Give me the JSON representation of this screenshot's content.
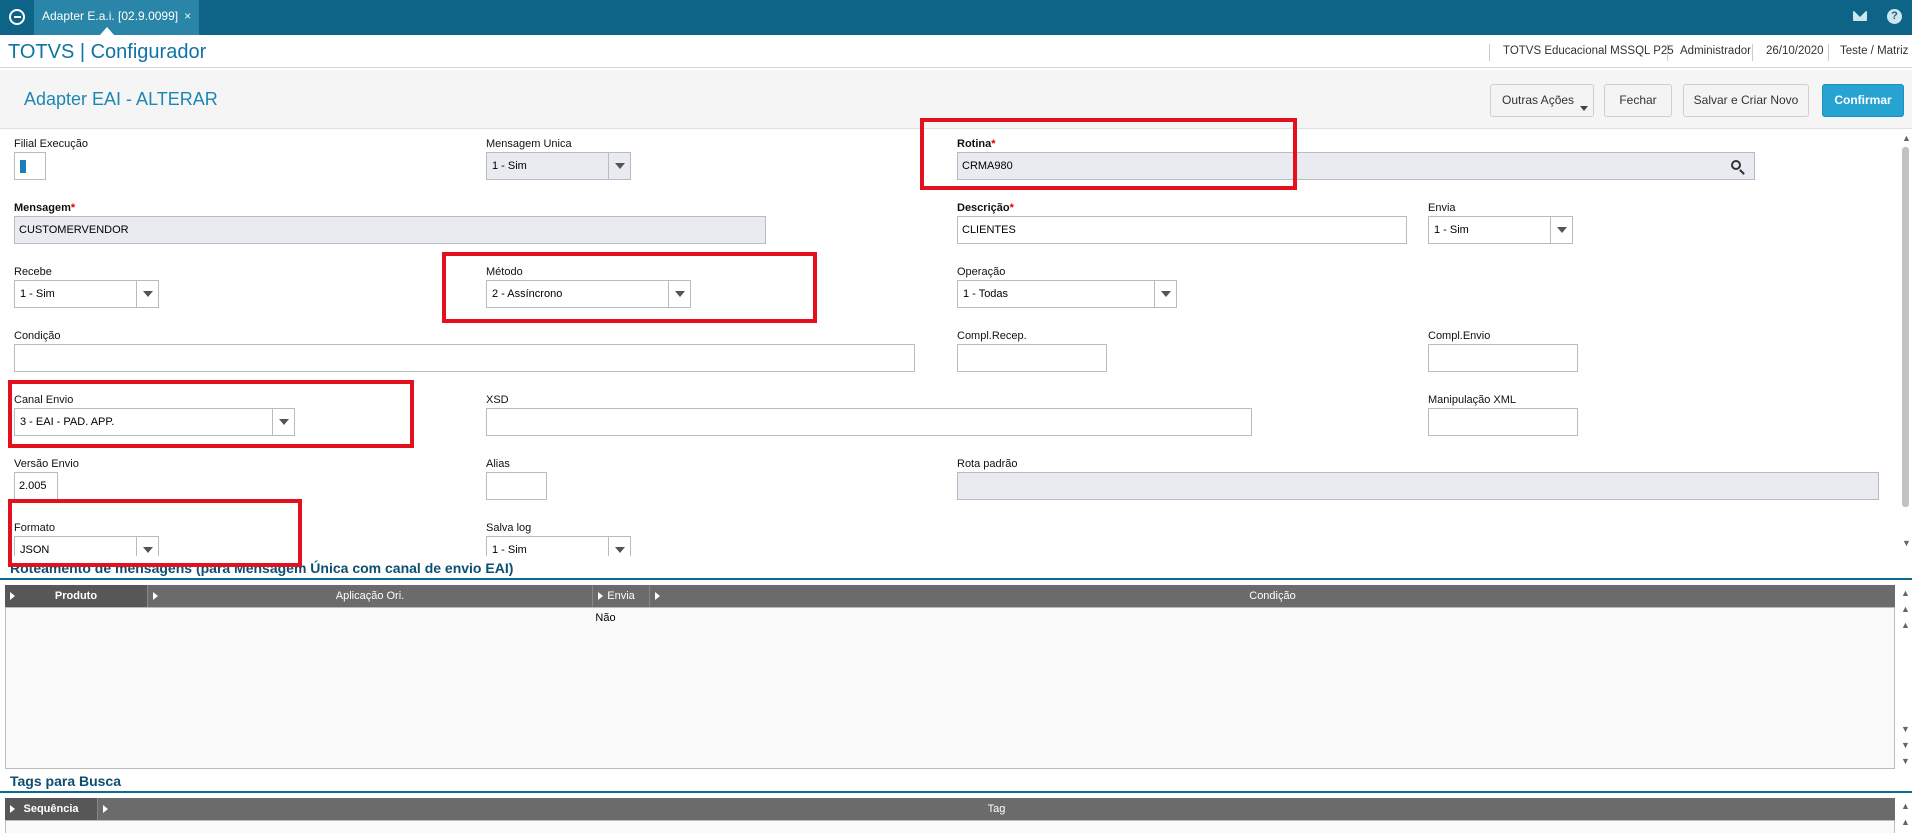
{
  "topbar": {
    "tab_label": "Adapter E.a.i. [02.9.0099]",
    "tab_close": "×",
    "icons": [
      "app-logo-icon",
      "mail-icon",
      "help-icon"
    ]
  },
  "header": {
    "app_title": "TOTVS | Configurador",
    "environment": "TOTVS Educacional MSSQL P25",
    "user": "Administrador",
    "date": "26/10/2020",
    "branch": "Teste / Matriz"
  },
  "form": {
    "title": "Adapter EAI - ALTERAR",
    "buttons": {
      "outras": "Outras Ações",
      "fechar": "Fechar",
      "salvar": "Salvar e Criar Novo",
      "confirmar": "Confirmar"
    },
    "fields": {
      "filial_execucao": {
        "label": "Filial Execução",
        "value": ""
      },
      "mensagem_unica": {
        "label": "Mensagem Unica",
        "value": "1 - Sim"
      },
      "rotina": {
        "label": "Rotina",
        "value": "CRMA980",
        "required": "*"
      },
      "mensagem": {
        "label": "Mensagem",
        "value": "CUSTOMERVENDOR",
        "required": "*"
      },
      "descricao": {
        "label": "Descrição",
        "value": "CLIENTES",
        "required": "*"
      },
      "envia": {
        "label": "Envia",
        "value": "1 - Sim"
      },
      "recebe": {
        "label": "Recebe",
        "value": "1 - Sim"
      },
      "metodo": {
        "label": "Método",
        "value": "2 - Assíncrono"
      },
      "operacao": {
        "label": "Operação",
        "value": "1 - Todas"
      },
      "condicao": {
        "label": "Condição",
        "value": ""
      },
      "compl_recep": {
        "label": "Compl.Recep.",
        "value": ""
      },
      "compl_envio": {
        "label": "Compl.Envio",
        "value": ""
      },
      "canal_envio": {
        "label": "Canal Envio",
        "value": "3 - EAI - PAD. APP."
      },
      "xsd": {
        "label": "XSD",
        "value": ""
      },
      "manipulacao_xml": {
        "label": "Manipulação XML",
        "value": ""
      },
      "versao_envio": {
        "label": "Versão Envio",
        "value": "2.005"
      },
      "alias": {
        "label": "Alias",
        "value": ""
      },
      "rota_padrao": {
        "label": "Rota padrão",
        "value": ""
      },
      "formato": {
        "label": "Formato",
        "value": "JSON"
      },
      "salva_log": {
        "label": "Salva log",
        "value": "1 - Sim"
      }
    }
  },
  "roteamento": {
    "title": "Roteamento de mensagens (para Mensagem Única com canal de envio EAI)",
    "columns": [
      "Produto",
      "Aplicação Ori.",
      "Envia",
      "Condição"
    ],
    "rows": [
      [
        "",
        "",
        "Não",
        ""
      ]
    ]
  },
  "tags": {
    "title": "Tags para Busca",
    "columns": [
      "Sequência",
      "Tag"
    ]
  },
  "colors": {
    "topbar": "#0d6487",
    "accent": "#1c86b4",
    "confirm": "#26a3d1",
    "highlight": "#e3101e"
  }
}
